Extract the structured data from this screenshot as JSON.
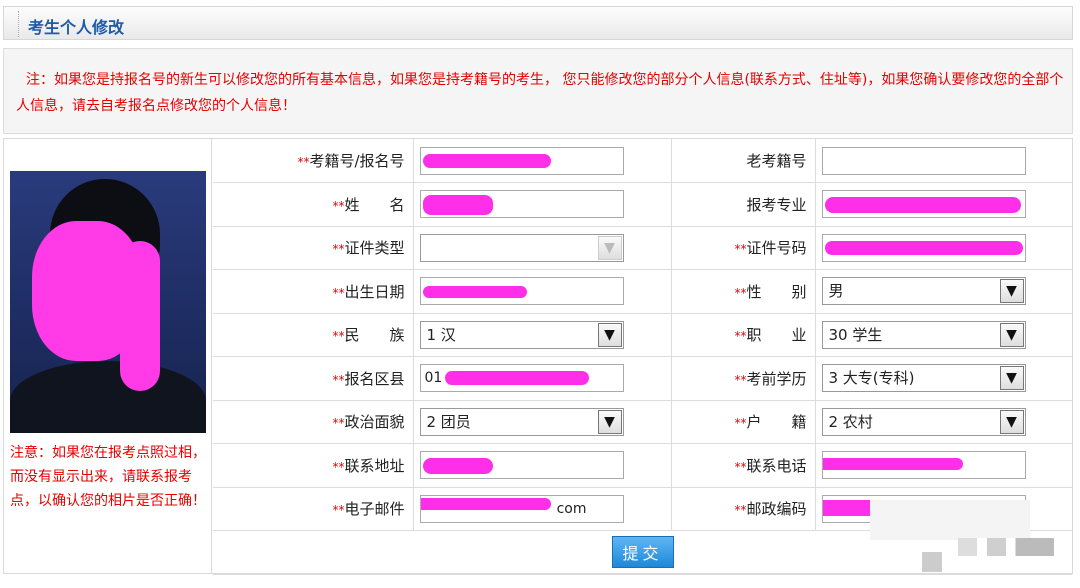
{
  "header": {
    "title": "考生个人修改"
  },
  "notice": {
    "text": "注：如果您是持报名号的新生可以修改您的所有基本信息，如果您是持考籍号的考生， 您只能修改您的部分个人信息(联系方式、住址等)，如果您确认要修改您的全部个人信息，请去自考报名点修改您的个人信息！"
  },
  "photo": {
    "note": "注意：如果您在报考点照过相，而没有显示出来，请联系报考点，以确认您的相片是否正确！"
  },
  "required_mark": "**",
  "fields": {
    "exam_no": {
      "label": "考籍号/报名号",
      "value": ""
    },
    "old_exam_no": {
      "label": "老考籍号",
      "value": ""
    },
    "name": {
      "label": "姓　　名",
      "value": ""
    },
    "major": {
      "label": "报考专业",
      "value": ""
    },
    "id_type": {
      "label": "证件类型",
      "value": ""
    },
    "id_number": {
      "label": "证件号码",
      "value": ""
    },
    "birth_date": {
      "label": "出生日期",
      "value": ""
    },
    "gender": {
      "label": "性　　别",
      "value": "男"
    },
    "ethnicity": {
      "label": "民　　族",
      "value": "1 汉"
    },
    "occupation": {
      "label": "职　　业",
      "value": "30 学生"
    },
    "region": {
      "label": "报名区县",
      "value": "01"
    },
    "education": {
      "label": "考前学历",
      "value": "3 大专(专科)"
    },
    "political": {
      "label": "政治面貌",
      "value": "2 团员"
    },
    "household": {
      "label": "户　　籍",
      "value": "2 农村"
    },
    "address": {
      "label": "联系地址",
      "value": ""
    },
    "phone": {
      "label": "联系电话",
      "value": ""
    },
    "email": {
      "label": "电子邮件",
      "value": "com"
    },
    "postcode": {
      "label": "邮政编码",
      "value": ""
    }
  },
  "submit": {
    "label": "提交"
  },
  "colors": {
    "accent": "#1d5aa8",
    "required": "#e60000",
    "redaction": "#ff2ee8",
    "button": "#1e88d8"
  }
}
